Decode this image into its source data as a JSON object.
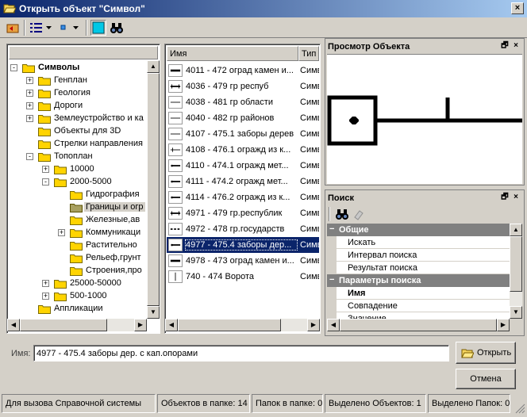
{
  "window": {
    "title": "Открыть объект \"Символ\"",
    "close_glyph": "×"
  },
  "toolbar": {
    "buttons": [
      {
        "name": "folder-up-icon"
      },
      {
        "name": "view-mode-icon"
      },
      {
        "name": "small-icon"
      },
      {
        "name": "preview-toggle-icon"
      },
      {
        "name": "binoculars-icon"
      }
    ]
  },
  "tree": {
    "items": [
      {
        "label": "Символы",
        "level": 0,
        "expander": "-",
        "bold": true
      },
      {
        "label": "Генплан",
        "level": 1,
        "expander": "+"
      },
      {
        "label": "Геология",
        "level": 1,
        "expander": "+"
      },
      {
        "label": "Дороги",
        "level": 1,
        "expander": "+"
      },
      {
        "label": "Землеустройство и ка",
        "level": 1,
        "expander": "+"
      },
      {
        "label": "Объекты для 3D",
        "level": 1,
        "expander": ""
      },
      {
        "label": "Стрелки направления",
        "level": 1,
        "expander": ""
      },
      {
        "label": "Топоплан",
        "level": 1,
        "expander": "-"
      },
      {
        "label": "10000",
        "level": 2,
        "expander": "+"
      },
      {
        "label": "2000-5000",
        "level": 2,
        "expander": "-"
      },
      {
        "label": "Гидрография",
        "level": 3,
        "expander": ""
      },
      {
        "label": "Границы и огр",
        "level": 3,
        "expander": "",
        "selected": true
      },
      {
        "label": "Железные,ав",
        "level": 3,
        "expander": ""
      },
      {
        "label": "Коммуникаци",
        "level": 3,
        "expander": "+"
      },
      {
        "label": "Растительно",
        "level": 3,
        "expander": ""
      },
      {
        "label": "Рельеф,грунт",
        "level": 3,
        "expander": ""
      },
      {
        "label": "Строения,про",
        "level": 3,
        "expander": ""
      },
      {
        "label": "25000-50000",
        "level": 2,
        "expander": "+"
      },
      {
        "label": "500-1000",
        "level": 2,
        "expander": "+"
      },
      {
        "label": "Аппликации",
        "level": 1,
        "expander": ""
      }
    ]
  },
  "list": {
    "col_name": "Имя",
    "col_type": "Тип",
    "rows": [
      {
        "name": "4011 - 472 оград камен и...",
        "type": "Симв",
        "icon": "thick-line"
      },
      {
        "name": "4036 - 479 гр респуб",
        "type": "Симв",
        "icon": "ticked-line"
      },
      {
        "name": "4038 - 481 гр области",
        "type": "Симв",
        "icon": "thin-line"
      },
      {
        "name": "4040 - 482 гр районов",
        "type": "Симв",
        "icon": "thin-line"
      },
      {
        "name": "4107 - 475.1 заборы дерев",
        "type": "Симв",
        "icon": "thin-line"
      },
      {
        "name": "4108 - 476.1 огражд из к...",
        "type": "Симв",
        "icon": "cross-line"
      },
      {
        "name": "4110 - 474.1 огражд мет...",
        "type": "Симв",
        "icon": "post-line"
      },
      {
        "name": "4111 - 474.2 огражд мет...",
        "type": "Симв",
        "icon": "post-line"
      },
      {
        "name": "4114 - 476.2 огражд из к...",
        "type": "Симв",
        "icon": "post-line"
      },
      {
        "name": "4971 - 479 гр.республик",
        "type": "Симв",
        "icon": "ticked-line"
      },
      {
        "name": "4972 - 478 гр.государств",
        "type": "Симв",
        "icon": "dot-line"
      },
      {
        "name": "4977 - 475.4 заборы дер...",
        "type": "Симв",
        "icon": "post-line",
        "selected": true
      },
      {
        "name": "4978 - 473 оград камен и...",
        "type": "Симв",
        "icon": "thick-line"
      },
      {
        "name": "740 - 474 Ворота",
        "type": "Симв",
        "icon": "vertical-bar"
      }
    ]
  },
  "preview_panel": {
    "title": "Просмотр Объекта",
    "pin_glyph": "🗗",
    "close_glyph": "×"
  },
  "search_panel": {
    "title": "Поиск",
    "pin_glyph": "🗗",
    "close_glyph": "×",
    "rows": [
      {
        "kind": "cat",
        "mark": "−",
        "label": "Общие"
      },
      {
        "kind": "item",
        "label": "Искать"
      },
      {
        "kind": "item",
        "label": "Интервал поиска"
      },
      {
        "kind": "item",
        "label": "Результат поиска"
      },
      {
        "kind": "cat",
        "mark": "−",
        "label": "Параметры поиска"
      },
      {
        "kind": "item",
        "label": "Имя",
        "bold": true
      },
      {
        "kind": "item",
        "label": "Совпадение"
      },
      {
        "kind": "item",
        "label": "Значение"
      }
    ]
  },
  "name_field": {
    "label": "Имя:",
    "value": "4977 - 475.4 заборы дер. с кап.опорами"
  },
  "buttons": {
    "open": "Открыть",
    "cancel": "Отмена"
  },
  "status": {
    "help": "Для вызова Справочной системы",
    "objects_in_folder": "Объектов в папке: 14",
    "folders_in_folder": "Папок в папке: 0",
    "selected_objects": "Выделено Объектов: 1",
    "selected_folders": "Выделено Папок: 0"
  }
}
